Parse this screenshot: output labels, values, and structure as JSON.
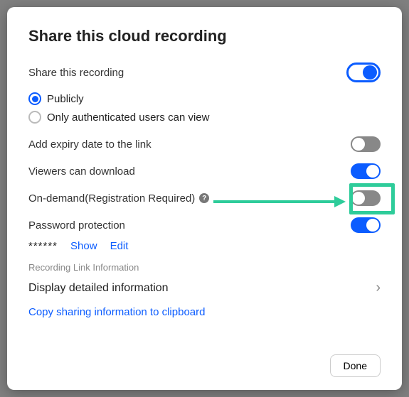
{
  "title": "Share this cloud recording",
  "share": {
    "label": "Share this recording",
    "options": {
      "publicly": "Publicly",
      "authenticated": "Only authenticated users can view"
    }
  },
  "expiry": {
    "label": "Add expiry date to the link"
  },
  "download": {
    "label": "Viewers can download"
  },
  "ondemand": {
    "label": "On-demand(Registration Required)"
  },
  "password": {
    "label": "Password protection",
    "mask": "******",
    "show": "Show",
    "edit": "Edit"
  },
  "linkinfo": {
    "heading": "Recording Link Information",
    "display": "Display detailed information",
    "copy": "Copy sharing information to clipboard"
  },
  "footer": {
    "done": "Done"
  }
}
